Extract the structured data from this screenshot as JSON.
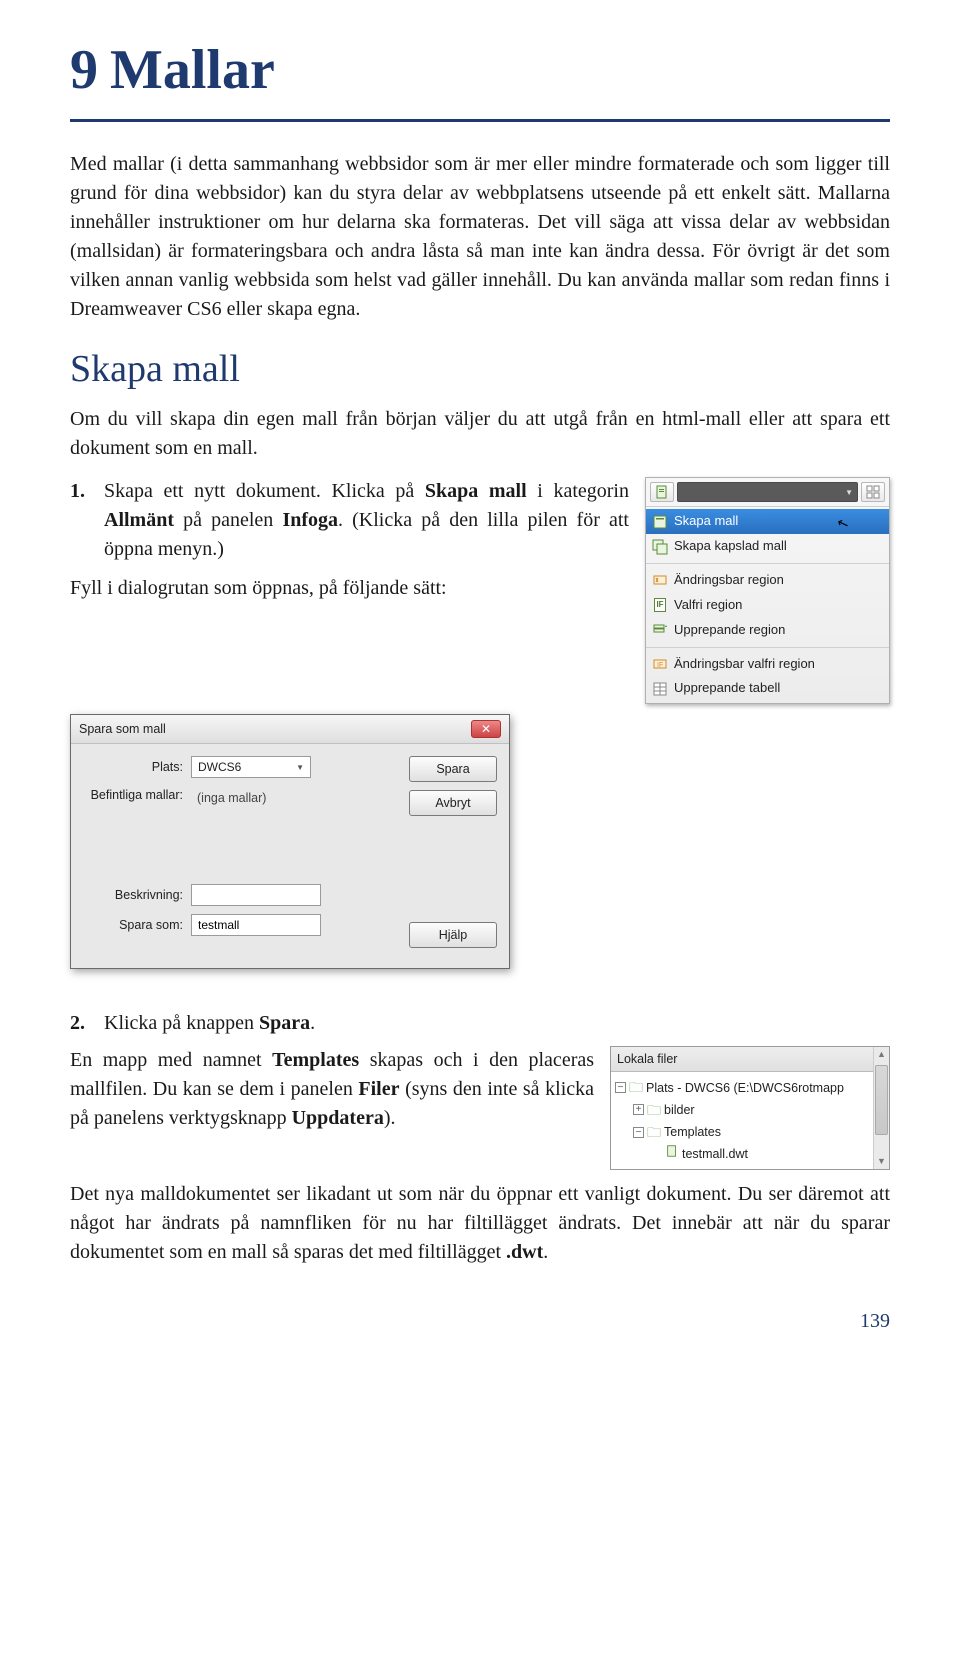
{
  "chapter": {
    "number": "9",
    "title": "Mallar"
  },
  "intro": {
    "p1": "Med mallar (i detta sammanhang webbsidor som är mer eller mindre formaterade och som ligger till grund för dina webbsidor) kan du styra delar av webbplatsens utseende på ett enkelt sätt. Mallarna innehåller instruktioner om hur delarna ska formateras. Det vill säga att vissa delar av webbsidan (mallsidan) är formateringsbara och andra låsta så man inte kan ändra dessa. För övrigt är det som vilken annan vanlig webbsida som helst vad gäller innehåll. Du kan använda mallar som redan finns i Dreamweaver CS6 eller skapa egna."
  },
  "section": {
    "heading": "Skapa mall",
    "p1": "Om du vill skapa din egen mall från början väljer du att utgå från en html-mall eller att spara ett dokument som en mall.",
    "step1_a": "Skapa ett nytt dokument. Klicka på ",
    "step1_b": "Skapa mall",
    "step1_c": " i kategorin ",
    "step1_d": "Allmänt",
    "step1_e": " på panelen ",
    "step1_f": "Infoga",
    "step1_g": ". (Klicka på den lilla pilen för att öppna menyn.)",
    "step1_num": "1.",
    "fill": "Fyll i dialogrutan som öppnas, på följande sätt:"
  },
  "menu": {
    "items": [
      {
        "label": "Skapa mall",
        "hl": true
      },
      {
        "label": "Skapa kapslad mall"
      },
      {
        "divider": true
      },
      {
        "label": "Ändringsbar region"
      },
      {
        "label": "Valfri region"
      },
      {
        "label": "Upprepande region"
      },
      {
        "divider": true
      },
      {
        "label": "Ändringsbar valfri region"
      },
      {
        "label": "Upprepande tabell"
      }
    ]
  },
  "dialog": {
    "title": "Spara som mall",
    "plats_label": "Plats:",
    "plats_value": "DWCS6",
    "existing_label": "Befintliga mallar:",
    "existing_value": "(inga mallar)",
    "beskrivning_label": "Beskrivning:",
    "beskrivning_value": "",
    "sparasom_label": "Spara som:",
    "sparasom_value": "testmall",
    "btn_save": "Spara",
    "btn_cancel": "Avbryt",
    "btn_help": "Hjälp"
  },
  "after": {
    "step2_num": "2.",
    "step2_a": "Klicka på knappen ",
    "step2_b": "Spara",
    "step2_c": ".",
    "p2_a": "En mapp med namnet ",
    "p2_b": "Templates",
    "p2_c": " skapas och i den placeras mallfilen. Du kan se dem i panelen ",
    "p2_d": "Filer",
    "p2_e": " (syns den inte så klicka på panelens verktygsknapp ",
    "p2_f": "Uppdatera",
    "p2_g": ").",
    "p3_a": "Det nya malldokumentet ser likadant ut som när du öppnar ett vanligt dokument. Du ser däremot att något har ändrats på namnfliken för nu har filtillägget ändrats. Det innebär att när du sparar dokumentet som en mall så sparas det med filtillägget ",
    "p3_b": ".dwt",
    "p3_c": "."
  },
  "filetree": {
    "header": "Lokala filer",
    "root": "Plats - DWCS6 (E:\\DWCS6rotmapp",
    "folder1": "bilder",
    "folder2": "Templates",
    "file1": "testmall.dwt"
  },
  "page_number": "139"
}
